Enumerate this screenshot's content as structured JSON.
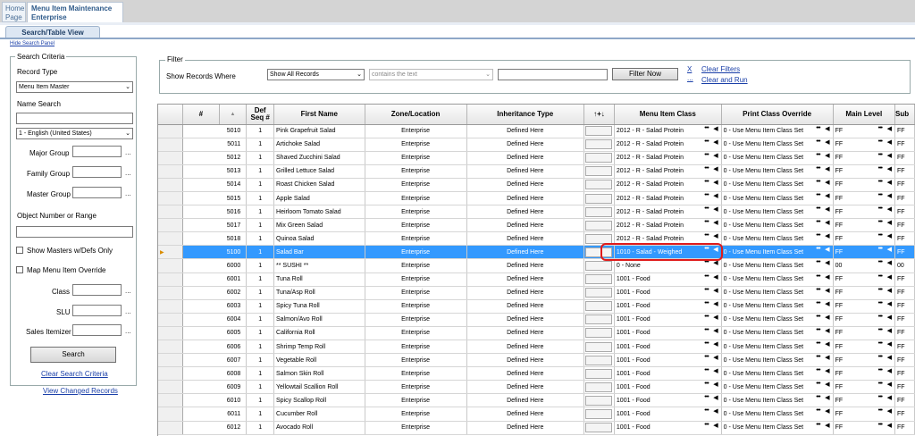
{
  "tabs": {
    "home": "Home Page",
    "active_line1": "Menu Item Maintenance",
    "active_line2": "Enterprise"
  },
  "subtab": "Search/Table View",
  "hide_search_panel": "Hide Search Panel",
  "search": {
    "legend": "Search Criteria",
    "record_type_label": "Record Type",
    "record_type_value": "Menu Item Master",
    "name_search_label": "Name Search",
    "language_value": "1 - English (United States)",
    "major_group": "Major Group",
    "family_group": "Family Group",
    "master_group": "Master Group",
    "object_number_label": "Object Number or Range",
    "show_masters": "Show Masters w/Defs Only",
    "map_override": "Map Menu Item Override",
    "class_label": "Class",
    "slu_label": "SLU",
    "sales_itemizer_label": "Sales Itemizer",
    "search_button": "Search",
    "clear_link": "Clear Search Criteria",
    "view_changed": "View Changed Records",
    "dots": "..."
  },
  "filter": {
    "legend": "Filter",
    "show_records_label": "Show Records Where",
    "field_value": "Show All Records",
    "op_value": "contains the text",
    "filter_now": "Filter Now",
    "x": "X",
    "clear_filters": "Clear Filters",
    "dots": "...",
    "clear_and_run": "Clear and Run"
  },
  "grid": {
    "headers": {
      "num": "#",
      "def_seq": "Def Seq #",
      "first_name": "First Name",
      "zone": "Zone/Location",
      "inherit": "Inheritance Type",
      "updown": "↑+↓",
      "mic": "Menu Item Class",
      "pco": "Print Class Override",
      "main_level": "Main Level",
      "sub": "Sub"
    },
    "rows": [
      {
        "num": "5010",
        "seq": "1",
        "name": "Pink Grapefruit Salad",
        "zone": "Enterprise",
        "inherit": "Defined Here",
        "mic": "2012 - R - Salad Protein",
        "pco": "0 - Use Menu Item Class Set",
        "ml": "FF",
        "sub": "FF"
      },
      {
        "num": "5011",
        "seq": "1",
        "name": "Artichoke Salad",
        "zone": "Enterprise",
        "inherit": "Defined Here",
        "mic": "2012 - R - Salad Protein",
        "pco": "0 - Use Menu Item Class Set",
        "ml": "FF",
        "sub": "FF"
      },
      {
        "num": "5012",
        "seq": "1",
        "name": "Shaved Zucchini Salad",
        "zone": "Enterprise",
        "inherit": "Defined Here",
        "mic": "2012 - R - Salad Protein",
        "pco": "0 - Use Menu Item Class Set",
        "ml": "FF",
        "sub": "FF"
      },
      {
        "num": "5013",
        "seq": "1",
        "name": "Grilled Lettuce Salad",
        "zone": "Enterprise",
        "inherit": "Defined Here",
        "mic": "2012 - R - Salad Protein",
        "pco": "0 - Use Menu Item Class Set",
        "ml": "FF",
        "sub": "FF"
      },
      {
        "num": "5014",
        "seq": "1",
        "name": "Roast Chicken Salad",
        "zone": "Enterprise",
        "inherit": "Defined Here",
        "mic": "2012 - R - Salad Protein",
        "pco": "0 - Use Menu Item Class Set",
        "ml": "FF",
        "sub": "FF"
      },
      {
        "num": "5015",
        "seq": "1",
        "name": "Apple Salad",
        "zone": "Enterprise",
        "inherit": "Defined Here",
        "mic": "2012 - R - Salad Protein",
        "pco": "0 - Use Menu Item Class Set",
        "ml": "FF",
        "sub": "FF"
      },
      {
        "num": "5016",
        "seq": "1",
        "name": "Heirloom Tomato Salad",
        "zone": "Enterprise",
        "inherit": "Defined Here",
        "mic": "2012 - R - Salad Protein",
        "pco": "0 - Use Menu Item Class Set",
        "ml": "FF",
        "sub": "FF"
      },
      {
        "num": "5017",
        "seq": "1",
        "name": "Mix Green Salad",
        "zone": "Enterprise",
        "inherit": "Defined Here",
        "mic": "2012 - R - Salad Protein",
        "pco": "0 - Use Menu Item Class Set",
        "ml": "FF",
        "sub": "FF"
      },
      {
        "num": "5018",
        "seq": "1",
        "name": "Quinoa Salad",
        "zone": "Enterprise",
        "inherit": "Defined Here",
        "mic": "2012 - R - Salad Protein",
        "pco": "0 - Use Menu Item Class Set",
        "ml": "FF",
        "sub": "FF"
      },
      {
        "num": "5100",
        "seq": "1",
        "name": "Salad Bar",
        "zone": "Enterprise",
        "inherit": "Defined Here",
        "mic": "1010 - Salad - Weighed",
        "pco": "0 - Use Menu Item Class Set",
        "ml": "FF",
        "sub": "FF",
        "selected": true
      },
      {
        "num": "6000",
        "seq": "1",
        "name": "** SUSHI **",
        "zone": "Enterprise",
        "inherit": "Defined Here",
        "mic": "0 - None",
        "pco": "0 - Use Menu Item Class Set",
        "ml": "00",
        "sub": "00"
      },
      {
        "num": "6001",
        "seq": "1",
        "name": "Tuna Roll",
        "zone": "Enterprise",
        "inherit": "Defined Here",
        "mic": "1001 - Food",
        "pco": "0 - Use Menu Item Class Set",
        "ml": "FF",
        "sub": "FF"
      },
      {
        "num": "6002",
        "seq": "1",
        "name": "Tuna/Asp Roll",
        "zone": "Enterprise",
        "inherit": "Defined Here",
        "mic": "1001 - Food",
        "pco": "0 - Use Menu Item Class Set",
        "ml": "FF",
        "sub": "FF"
      },
      {
        "num": "6003",
        "seq": "1",
        "name": "Spicy Tuna Roll",
        "zone": "Enterprise",
        "inherit": "Defined Here",
        "mic": "1001 - Food",
        "pco": "0 - Use Menu Item Class Set",
        "ml": "FF",
        "sub": "FF"
      },
      {
        "num": "6004",
        "seq": "1",
        "name": "Salmon/Avo Roll",
        "zone": "Enterprise",
        "inherit": "Defined Here",
        "mic": "1001 - Food",
        "pco": "0 - Use Menu Item Class Set",
        "ml": "FF",
        "sub": "FF"
      },
      {
        "num": "6005",
        "seq": "1",
        "name": "California Roll",
        "zone": "Enterprise",
        "inherit": "Defined Here",
        "mic": "1001 - Food",
        "pco": "0 - Use Menu Item Class Set",
        "ml": "FF",
        "sub": "FF"
      },
      {
        "num": "6006",
        "seq": "1",
        "name": "Shrimp Temp Roll",
        "zone": "Enterprise",
        "inherit": "Defined Here",
        "mic": "1001 - Food",
        "pco": "0 - Use Menu Item Class Set",
        "ml": "FF",
        "sub": "FF"
      },
      {
        "num": "6007",
        "seq": "1",
        "name": "Vegetable Roll",
        "zone": "Enterprise",
        "inherit": "Defined Here",
        "mic": "1001 - Food",
        "pco": "0 - Use Menu Item Class Set",
        "ml": "FF",
        "sub": "FF"
      },
      {
        "num": "6008",
        "seq": "1",
        "name": "Salmon Skin Roll",
        "zone": "Enterprise",
        "inherit": "Defined Here",
        "mic": "1001 - Food",
        "pco": "0 - Use Menu Item Class Set",
        "ml": "FF",
        "sub": "FF"
      },
      {
        "num": "6009",
        "seq": "1",
        "name": "Yellowtail Scallion Roll",
        "zone": "Enterprise",
        "inherit": "Defined Here",
        "mic": "1001 - Food",
        "pco": "0 - Use Menu Item Class Set",
        "ml": "FF",
        "sub": "FF"
      },
      {
        "num": "6010",
        "seq": "1",
        "name": "Spicy Scallop Roll",
        "zone": "Enterprise",
        "inherit": "Defined Here",
        "mic": "1001 - Food",
        "pco": "0 - Use Menu Item Class Set",
        "ml": "FF",
        "sub": "FF"
      },
      {
        "num": "6011",
        "seq": "1",
        "name": "Cucumber Roll",
        "zone": "Enterprise",
        "inherit": "Defined Here",
        "mic": "1001 - Food",
        "pco": "0 - Use Menu Item Class Set",
        "ml": "FF",
        "sub": "FF"
      },
      {
        "num": "6012",
        "seq": "1",
        "name": "Avocado Roll",
        "zone": "Enterprise",
        "inherit": "Defined Here",
        "mic": "1001 - Food",
        "pco": "0 - Use Menu Item Class Set",
        "ml": "FF",
        "sub": "FF"
      }
    ],
    "ellipsis": "•••",
    "arrow": "◀",
    "row_pointer": "▶"
  },
  "colors": {
    "selected_row": "#3399ff",
    "highlight": "#e01b1b",
    "link": "#1a3fa8"
  }
}
